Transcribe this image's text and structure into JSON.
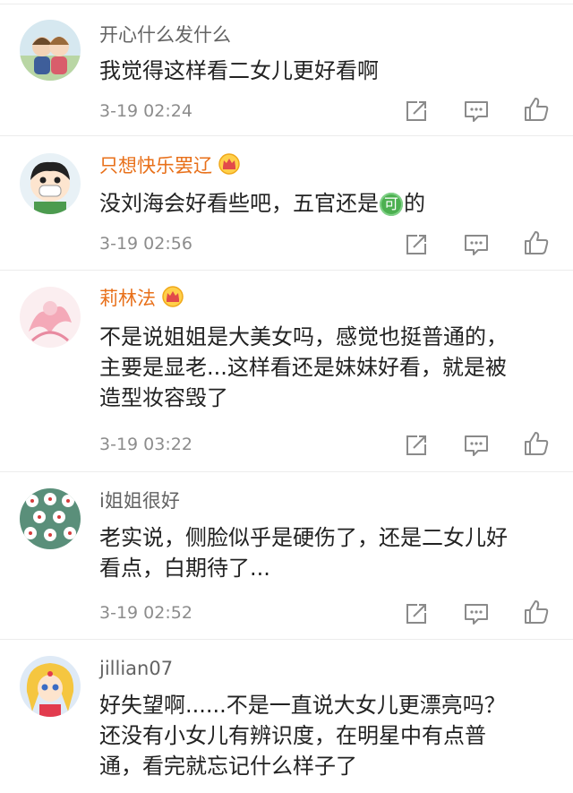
{
  "comments": [
    {
      "username": "开心什么发什么",
      "lines": [
        "我觉得这样看二女儿更好看啊"
      ],
      "time": "3-19 02:24"
    },
    {
      "username": "只想快乐罢辽",
      "lines_parts": [
        "没刘海会好看些吧，五官还是",
        "可",
        "的"
      ],
      "time": "3-19 02:56"
    },
    {
      "username": "莉林法",
      "lines": [
        "不是说姐姐是大美女吗，感觉也挺普通的，",
        "主要是显老...这样看还是妹妹好看，就是被",
        "造型妆容毁了"
      ],
      "time": "3-19 03:22"
    },
    {
      "username": "i姐姐很好",
      "lines": [
        "老实说，侧脸似乎是硬伤了，还是二女儿好",
        "看点，白期待了..."
      ],
      "time": "3-19 02:52"
    },
    {
      "username": "jillian07",
      "lines": [
        "好失望啊......不是一直说大女儿更漂亮吗？",
        "还没有小女儿有辨识度，在明星中有点普",
        "通，看完就忘记什么样子了"
      ]
    }
  ],
  "icons": {
    "share": "share-icon",
    "comment": "comment-icon",
    "like": "like-icon",
    "vip": "vip-crown-icon"
  },
  "colors": {
    "vip_name": "#e8701a",
    "name": "#636363",
    "time": "#8c8c8c",
    "text": "#222222"
  }
}
